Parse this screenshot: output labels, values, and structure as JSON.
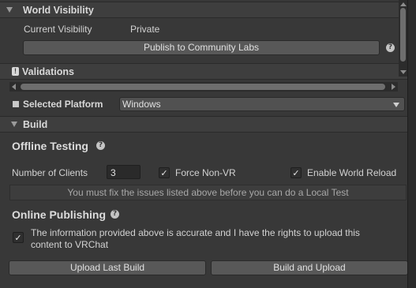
{
  "world_visibility": {
    "header": "World Visibility",
    "current_label": "Current Visibility",
    "current_value": "Private",
    "publish_button": "Publish to Community Labs",
    "help_glyph": "?"
  },
  "validations": {
    "header": "Validations"
  },
  "platform": {
    "label": "Selected Platform",
    "value": "Windows"
  },
  "build": {
    "header": "Build",
    "offline": {
      "title": "Offline Testing",
      "clients_label": "Number of Clients",
      "clients_value": "3",
      "force_nonvr_label": "Force Non-VR",
      "force_nonvr_checked": true,
      "enable_reload_label": "Enable World Reload",
      "enable_reload_checked": true,
      "warning": "You must fix the issues listed above before you can do a Local Test"
    },
    "online": {
      "title": "Online Publishing",
      "consent_text_line1": "The information provided above is accurate and I have the rights to upload this",
      "consent_text_line2": "content to VRChat",
      "consent_checked": true
    },
    "upload_last_button": "Upload Last Build",
    "build_upload_button": "Build and Upload"
  },
  "glyphs": {
    "check": "✓",
    "help": "?",
    "warning_icon": "!"
  },
  "colors": {
    "background": "#383838",
    "header_background": "#3e3e3e",
    "button": "#585858",
    "field": "#2a2a2a"
  }
}
